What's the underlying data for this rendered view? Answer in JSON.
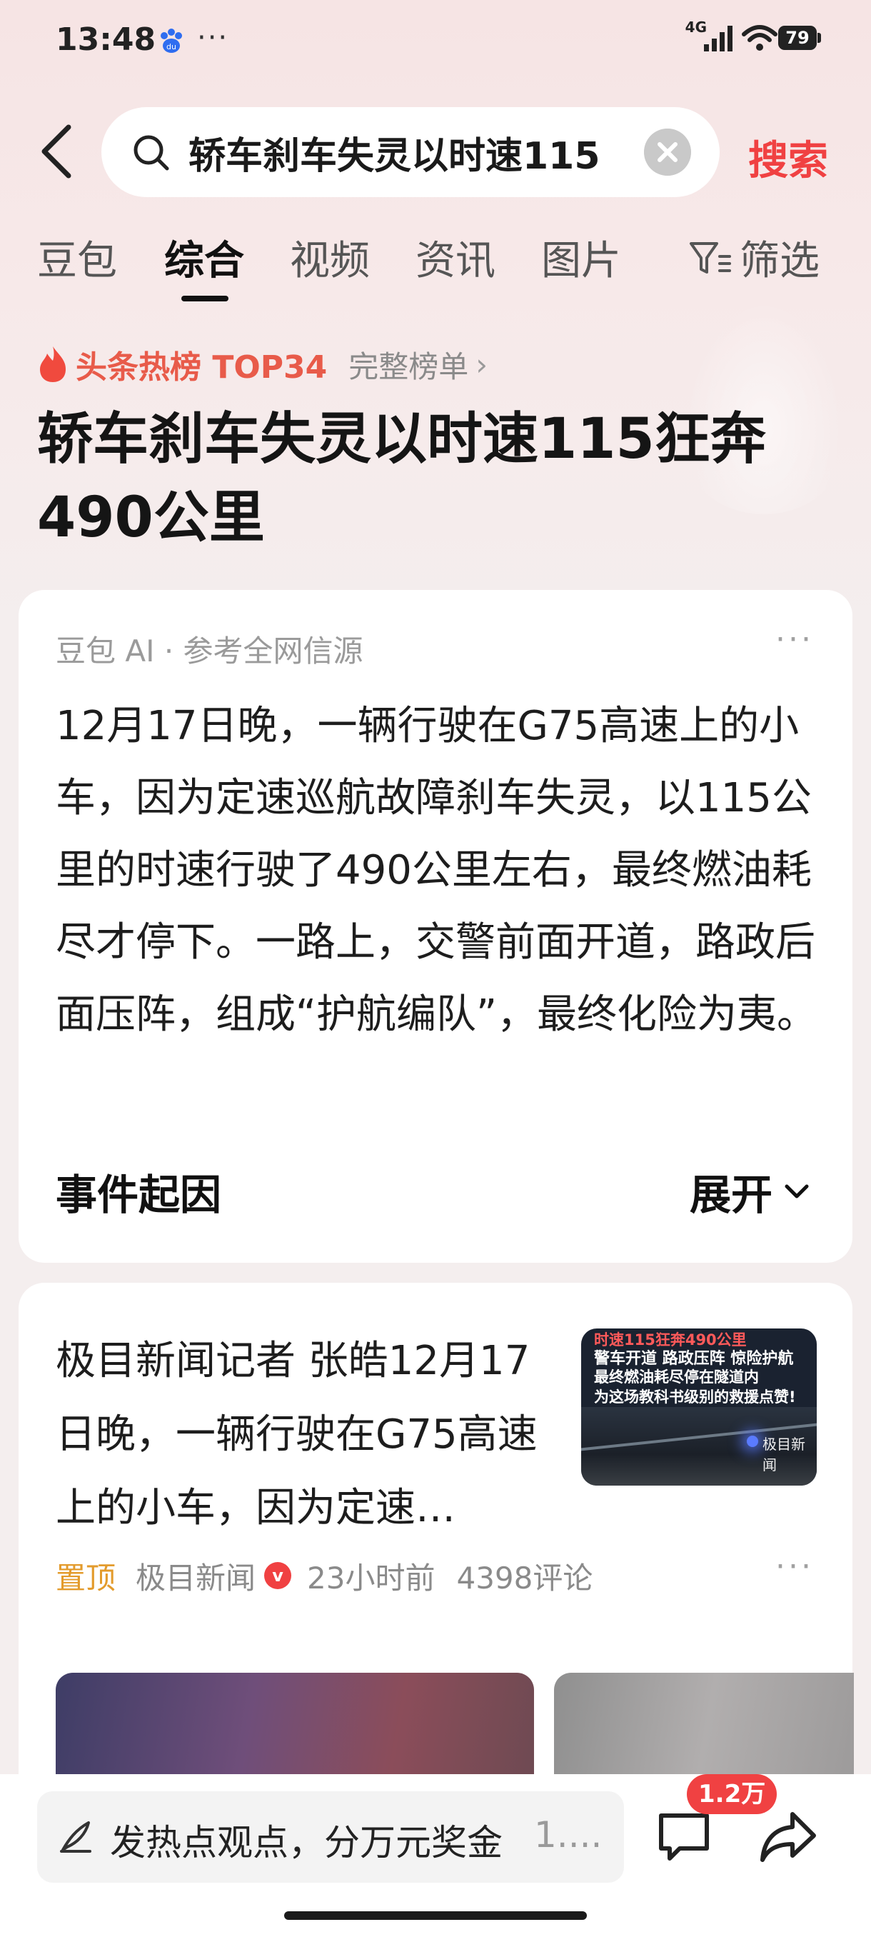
{
  "status_bar": {
    "time": "13:48",
    "dots": "···",
    "network": "4G",
    "battery": "79"
  },
  "search": {
    "query": "轿车刹车失灵以时速115",
    "button_label": "搜索"
  },
  "tabs": [
    {
      "label": "豆包"
    },
    {
      "label": "综合"
    },
    {
      "label": "视频"
    },
    {
      "label": "资讯"
    },
    {
      "label": "图片"
    }
  ],
  "active_tab": "综合",
  "filter_label": "筛选",
  "hot_rank": {
    "title": "头条热榜 TOP34",
    "link": "完整榜单"
  },
  "headline": "轿车刹车失灵以时速115狂奔490公里",
  "ai_card": {
    "source": "豆包 AI · 参考全网信源",
    "more": "···",
    "text": "12月17日晚，一辆行驶在G75高速上的小车，因为定速巡航故障刹车失灵，以115公里的时速行驶了490公里左右，最终燃油耗尽才停下。一路上，交警前面开道，路政后面压阵，组成“护航编队”，最终化险为夷。",
    "section_title": "事件起因",
    "expand_label": "展开"
  },
  "news_card": {
    "text": "极目新闻记者 张皓12月17日晚，一辆行驶在G75高速上的小车，因为定速…",
    "thumbnail": {
      "line1": "时速115狂奔490公里",
      "line2": "警车开道 路政压阵 惊险护航",
      "line3": "最终燃油耗尽停在隧道内",
      "line4": "为这场教科书级别的救援点赞!",
      "watermark": "极目新闻"
    },
    "pin_label": "置顶",
    "source": "极目新闻",
    "verified": "v",
    "time_ago": "23小时前",
    "comments": "4398评论",
    "more": "···"
  },
  "bottom_bar": {
    "comment_placeholder": "发热点观点，分万元奖金",
    "comment_more": "1....",
    "comment_count": "1.2万"
  },
  "colors": {
    "accent": "#f04142",
    "hot": "#e85b4a",
    "pin": "#e39b2c"
  }
}
